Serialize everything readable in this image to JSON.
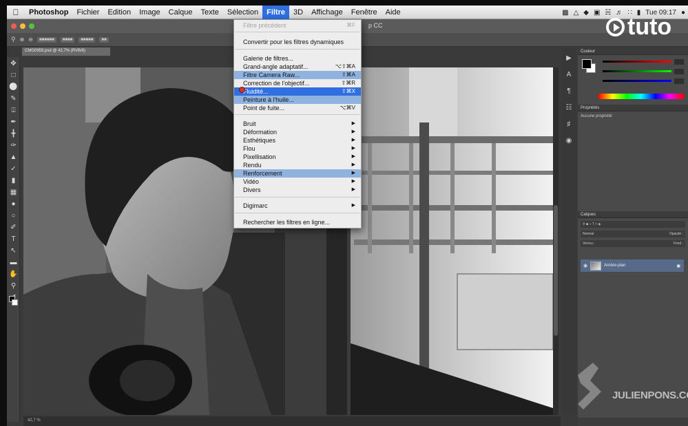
{
  "menubar": {
    "app": "Photoshop",
    "items": [
      "Fichier",
      "Edition",
      "Image",
      "Calque",
      "Texte",
      "Sélection",
      "Filtre",
      "3D",
      "Affichage",
      "Fenêtre",
      "Aide"
    ],
    "active": "Filtre",
    "clock": "Tue 09:17"
  },
  "ps": {
    "title_fragment": "p CC"
  },
  "document": {
    "tab": "CMG0959.psd @ 42,7% (RVB/8)"
  },
  "filter_menu": {
    "last_filter": "Filtre précédent",
    "last_filter_shortcut": "⌘F",
    "convert": "Convertir pour les filtres dynamiques",
    "items_a": [
      {
        "label": "Galerie de filtres...",
        "shortcut": ""
      },
      {
        "label": "Grand-angle adaptatif...",
        "shortcut": "⌥⇧⌘A"
      },
      {
        "label": "Filtre Camera Raw...",
        "shortcut": "⇧⌘A"
      },
      {
        "label": "Correction de l'objectif...",
        "shortcut": "⇧⌘R"
      },
      {
        "label": "Fluidité...",
        "shortcut": "⇧⌘X"
      },
      {
        "label": "Peinture à l'huile...",
        "shortcut": ""
      },
      {
        "label": "Point de fuite...",
        "shortcut": "⌥⌘V"
      }
    ],
    "items_b": [
      "Bruit",
      "Déformation",
      "Esthétiques",
      "Flou",
      "Pixellisation",
      "Rendu",
      "Renforcement",
      "Vidéo",
      "Divers"
    ],
    "digimarc": "Digimarc",
    "search_online": "Rechercher les filtres en ligne..."
  },
  "panels": {
    "color_title": "Couleur",
    "properties_title": "Propriétés",
    "properties_text": "Aucune propriété",
    "layers_title": "Calques",
    "layer_name": "Arrière-plan",
    "blend_mode": "Normal",
    "opacity_label": "Opacité :",
    "fill_label": "Fond :",
    "lock_label": "Verrou :"
  },
  "watermark": {
    "tuto": "tuto",
    "site": "JULIENPONS.COM"
  },
  "status": {
    "zoom": "42,7 %"
  }
}
